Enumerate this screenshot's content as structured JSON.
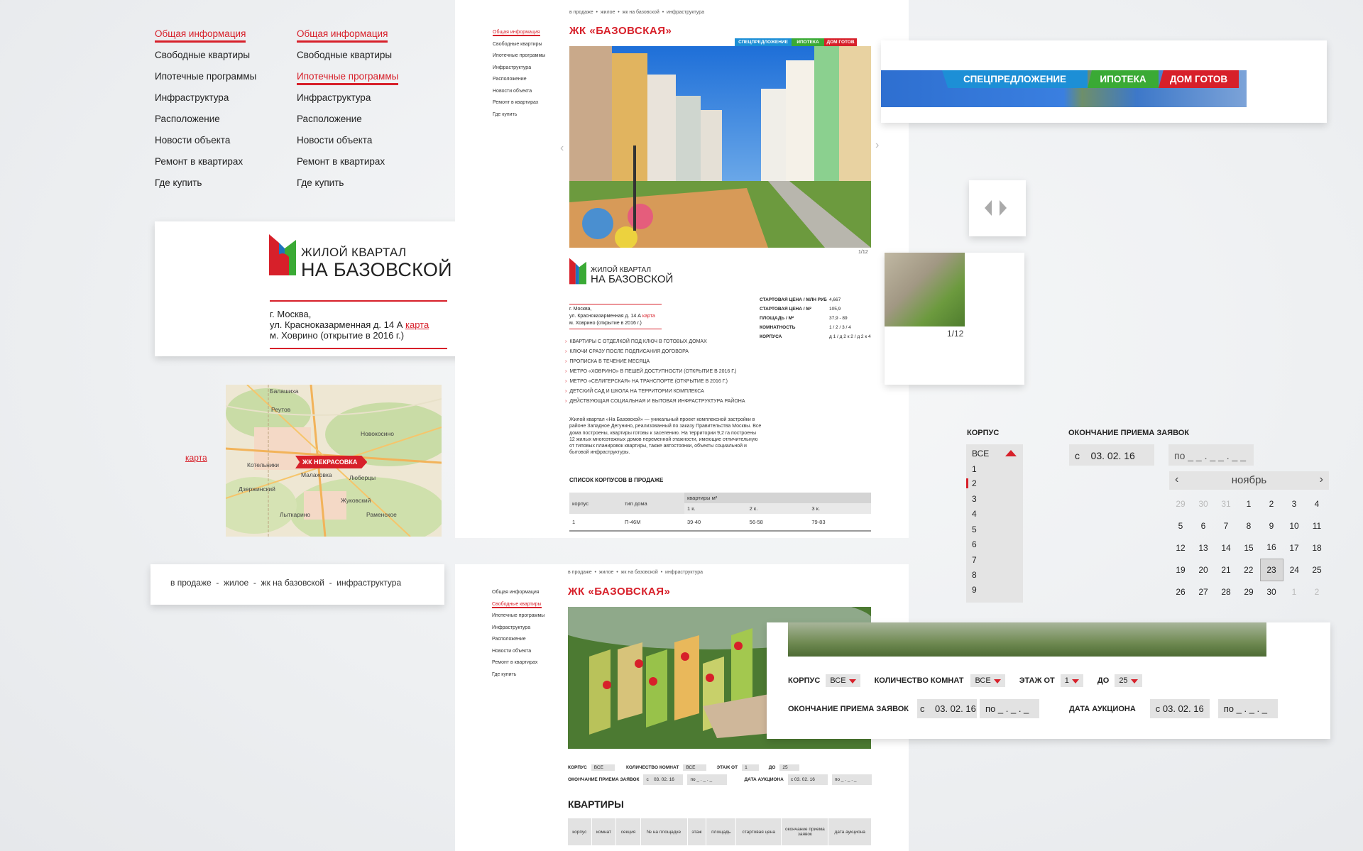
{
  "nav": {
    "items": [
      "Общая информация",
      "Свободные квартиры",
      "Ипотечные программы",
      "Инфраструктура",
      "Расположение",
      "Новости объекта",
      "Ремонт в квартирах",
      "Где купить"
    ]
  },
  "logo": {
    "line1": "ЖИЛОЙ КВАРТАЛ",
    "line2": "НА БАЗОВСКОЙ"
  },
  "address": {
    "city": "г. Москва,",
    "street": "ул. Красноказарменная д. 14 А",
    "map_link": "карта",
    "metro": "м. Ховрино (открытие в 2016 г.)"
  },
  "map": {
    "link": "карта",
    "marker": "ЖК НЕКРАСОВКА",
    "places": [
      "Балашиха",
      "Реутов",
      "Новокосино",
      "Котельники",
      "Малаховка",
      "Дзержинский",
      "Люберцы",
      "Жуковский",
      "Лыткарино",
      "Раменское"
    ]
  },
  "breadcrumb": {
    "large": "в продаже  -  жилое  -  жк на базовской  -  инфраструктура",
    "small": "в продаже  •  жилое  •  жк на базовской  •  инфраструктура"
  },
  "page": {
    "title": "ЖК «БАЗОВСКАЯ»",
    "badges": [
      "СПЕЦПРЕДЛОЖЕНИЕ",
      "ИПОТЕКА",
      "ДОМ ГОТОВ"
    ],
    "counter": "1/12",
    "info": [
      {
        "k": "СТАРТОВАЯ ЦЕНА / МЛН РУБ",
        "v": "4,667"
      },
      {
        "k": "СТАРТОВАЯ ЦЕНА / М²",
        "v": "105,9"
      },
      {
        "k": "ПЛОЩАДЬ / М²",
        "v": "37,9 - 89"
      },
      {
        "k": "КОМНАТНОСТЬ",
        "v": "1 / 2 / 3 / 4"
      },
      {
        "k": "КОРПУСА",
        "v": "д 1 / д 2 к 2 / д 2 к 4"
      }
    ],
    "features": [
      "КВАРТИРЫ С ОТДЕЛКОЙ ПОД КЛЮЧ В ГОТОВЫХ ДОМАХ",
      "КЛЮЧИ СРАЗУ ПОСЛЕ ПОДПИСАНИЯ ДОГОВОРА",
      "ПРОПИСКА В ТЕЧЕНИЕ МЕСЯЦА",
      "МЕТРО «ХОВРИНО» В ПЕШЕЙ ДОСТУПНОСТИ (ОТКРЫТИЕ В 2016 Г.)",
      "МЕТРО «СЕЛИГЕРСКАЯ» НА ТРАНСПОРТЕ (ОТКРЫТИЕ В 2016 Г.)",
      "ДЕТСКИЙ САД И ШКОЛА НА ТЕРРИТОРИИ КОМПЛЕКСА",
      "ДЕЙСТВУЮЩАЯ СОЦИАЛЬНАЯ И БЫТОВАЯ ИНФРАСТРУКТУРА РАЙОНА"
    ],
    "description": "Жилой квартал «На Базовской» — уникальный проект комплексной застройки в районе Западное Дегунино, реализованный по заказу Правительства Москвы. Все дома построены, квартиры готовы к заселению. На территории 9,2 га построены 12 жилых многоэтажных домов переменной этажности, имеющие отличительную от типовых планировок квартиры, также автостоянки, объекты социальной и бытовой инфраструктуры.",
    "list_title": "СПИСОК КОРПУСОВ В ПРОДАЖЕ",
    "table": {
      "h1": "корпус",
      "h2": "тип дома",
      "h3": "квартиры м²",
      "sub": [
        "1 к.",
        "2 к.",
        "3 к."
      ],
      "row": [
        "1",
        "П-46М",
        "39-40",
        "56-58",
        "79-83"
      ]
    }
  },
  "promo": [
    "СПЕЦПРЕДЛОЖЕНИЕ",
    "ИПОТЕКА",
    "ДОМ ГОТОВ"
  ],
  "korpus": {
    "label": "КОРПУС",
    "items": [
      "ВСЕ",
      "1",
      "2",
      "3",
      "4",
      "5",
      "6",
      "7",
      "8",
      "9"
    ]
  },
  "deadline": {
    "label": "ОКОНЧАНИЕ ПРИЕМА ЗАЯВОК",
    "from": "с    03. 02. 16",
    "to": "по _ _ . _ _ . _ _"
  },
  "calendar": {
    "month": "ноябрь",
    "weeks": [
      [
        "29",
        "30",
        "31",
        "1",
        "2",
        "3",
        "4"
      ],
      [
        "5",
        "6",
        "7",
        "8",
        "9",
        "10",
        "11"
      ],
      [
        "12",
        "13",
        "14",
        "15",
        "16",
        "17",
        "18"
      ],
      [
        "19",
        "20",
        "21",
        "22",
        "23",
        "24",
        "25"
      ],
      [
        "26",
        "27",
        "28",
        "29",
        "30",
        "1",
        "2"
      ]
    ]
  },
  "filters": {
    "korpus": "КОРПУС",
    "korpus_val": "ВСЕ",
    "rooms": "КОЛИЧЕСТВО КОМНАТ",
    "rooms_val": "ВСЕ",
    "floor_from": "ЭТАЖ ОТ",
    "floor_from_val": "1",
    "floor_to": "ДО",
    "floor_to_val": "25",
    "deadline": "ОКОНЧАНИЕ ПРИЕМА ЗАЯВОК",
    "deadline_from": "с    03. 02. 16",
    "deadline_to": "по _ . _ . _",
    "auction": "ДАТА АУКЦИОНА",
    "auction_from": "с 03. 02. 16",
    "auction_to": "по _ . _ . _"
  },
  "apartments": {
    "title": "КВАРТИРЫ",
    "cols": [
      "корпус",
      "комнат",
      "секция",
      "№ на площадке",
      "этаж",
      "площадь",
      "стартовая цена",
      "окончание приема заявок",
      "дата аукциона"
    ]
  }
}
